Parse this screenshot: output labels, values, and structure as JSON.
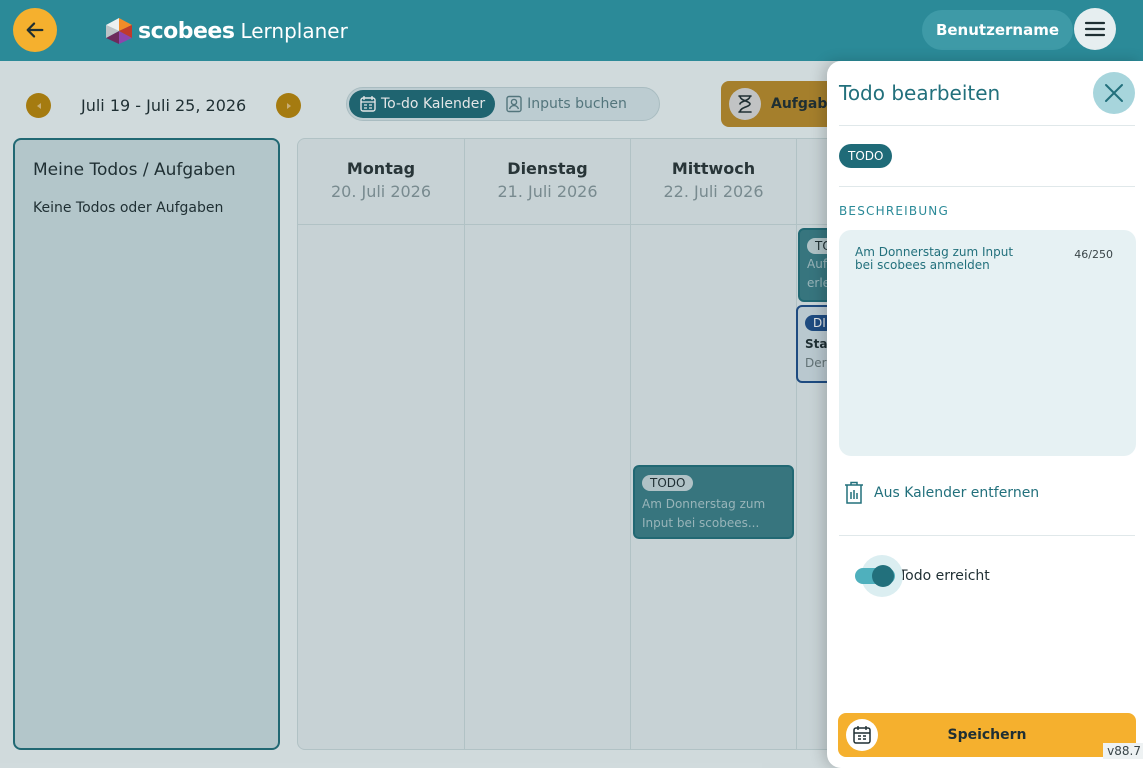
{
  "header": {
    "logo_brand": "scobees",
    "logo_product": "Lernplaner",
    "username": "Benutzername"
  },
  "week_nav": {
    "label": "Juli 19 - Juli 25, 2026"
  },
  "view_toggle": {
    "options": [
      "To-do Kalender",
      "Inputs buchen"
    ],
    "active": "To-do Kalender"
  },
  "tasks_button": {
    "label": "Aufgabe"
  },
  "todo_panel": {
    "title": "Meine Todos / Aufgaben",
    "empty_text": "Keine Todos oder Aufgaben"
  },
  "calendar": {
    "days": [
      {
        "day": "Montag",
        "date": "20. Juli 2026"
      },
      {
        "day": "Dienstag",
        "date": "21. Juli 2026"
      },
      {
        "day": "Mittwoch",
        "date": "22. Juli 2026"
      }
    ],
    "events": [
      {
        "tag": "TODO",
        "text": "Am Donnerstag zum Input bei scobees..."
      }
    ],
    "partial_events": [
      {
        "tag": "TO",
        "lines": [
          "Auf",
          "erle"
        ]
      },
      {
        "tag": "DI",
        "lines": [
          "Sta",
          "Der"
        ]
      }
    ]
  },
  "drawer": {
    "title": "Todo bearbeiten",
    "badge": "TODO",
    "description_label": "BESCHREIBUNG",
    "description_value": "Am Donnerstag zum Input bei scobees anmelden",
    "description_count": "46/250",
    "remove_label": "Aus Kalender entfernen",
    "toggle_label": "Todo erreicht",
    "toggle_on": true,
    "save_label": "Speichern"
  },
  "version": "v88.7",
  "colors": {
    "primary": "#2b8a98",
    "dark_teal": "#22707c",
    "accent": "#f5b02e"
  }
}
